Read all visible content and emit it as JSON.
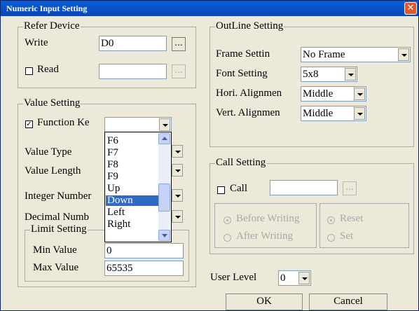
{
  "window": {
    "title": "Numeric Input Setting",
    "close_symbol": "✕"
  },
  "refer_device": {
    "legend": "Refer Device",
    "write_label": "Write",
    "write_value": "D0",
    "read_label": "Read",
    "read_value": "",
    "browse_label": "..."
  },
  "value_setting": {
    "legend": "Value Setting",
    "function_key_label": "Function Ke",
    "function_key_checked": "✓",
    "function_key_value": "",
    "value_type_label": "Value Type",
    "value_length_label": "Value Length",
    "integer_number_label": "Integer Number",
    "decimal_number_label": "Decimal Numb"
  },
  "limit_setting": {
    "legend": "Limit Setting",
    "min_label": "Min Value",
    "min_value": "0",
    "max_label": "Max Value",
    "max_value": "65535"
  },
  "dropdown": {
    "items": [
      "F6",
      "F7",
      "F8",
      "F9",
      "Up",
      "Down",
      "Left",
      "Right"
    ],
    "selected": "Down"
  },
  "outline": {
    "legend": "OutLine Setting",
    "frame_label": "Frame Settin",
    "frame_value": "No Frame",
    "font_label": "Font Setting",
    "font_value": "5x8",
    "hori_label": "Hori. Alignmen",
    "hori_value": "Middle",
    "vert_label": "Vert. Alignmen",
    "vert_value": "Middle"
  },
  "call_setting": {
    "legend": "Call Setting",
    "call_label": "Call",
    "call_value": "",
    "browse_label": "...",
    "before_writing": "Before Writing",
    "after_writing": "After Writing",
    "reset": "Reset",
    "set": "Set"
  },
  "user_level": {
    "label": "User Level",
    "value": "0"
  },
  "buttons": {
    "ok": "OK",
    "cancel": "Cancel"
  },
  "colors": {
    "titlebar": "#0b4fc4",
    "selection": "#316ac5",
    "close": "#e2582b"
  }
}
